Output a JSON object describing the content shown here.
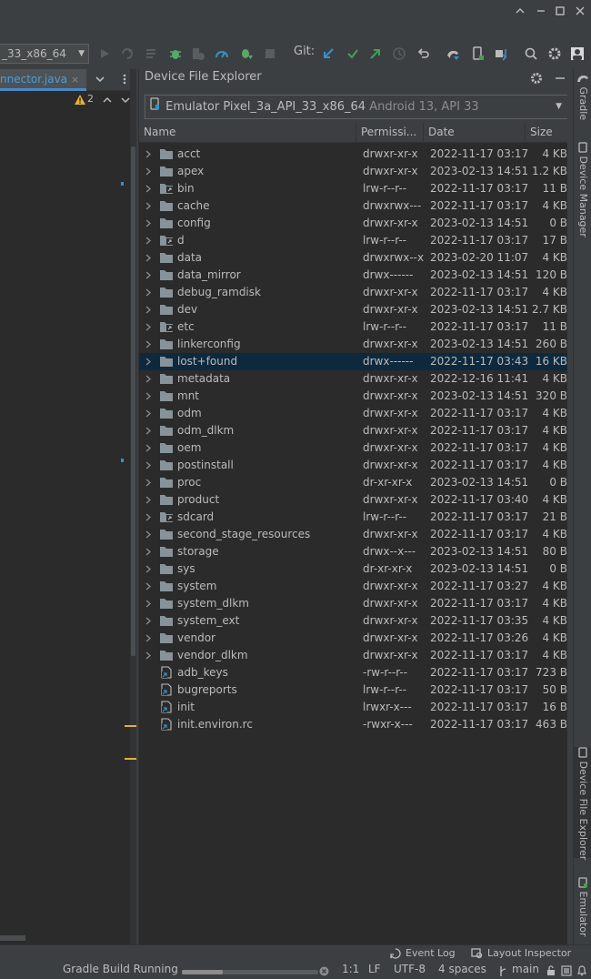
{
  "toolbar": {
    "run_config": "_33_x86_64",
    "git_label": "Git:"
  },
  "editor": {
    "tab_label": "nnector.java",
    "tab_close": "×",
    "warning_count": "2"
  },
  "panel": {
    "title": "Device File Explorer",
    "device_name": "Emulator Pixel_3a_API_33_x86_64",
    "device_api": "Android 13, API 33",
    "columns": {
      "name": "Name",
      "permissions": "Permissi...",
      "date": "Date",
      "size": "Size"
    }
  },
  "files": [
    {
      "name": "acct",
      "perm": "drwxr-xr-x",
      "date": "2022-11-17 03:17",
      "size": "4 KB",
      "kind": "folder"
    },
    {
      "name": "apex",
      "perm": "drwxr-xr-x",
      "date": "2023-02-13 14:51",
      "size": "1.2 KB",
      "kind": "folder"
    },
    {
      "name": "bin",
      "perm": "lrw-r--r--",
      "date": "2022-11-17 03:17",
      "size": "11 B",
      "kind": "folder-link"
    },
    {
      "name": "cache",
      "perm": "drwxrwx---",
      "date": "2022-11-17 03:17",
      "size": "4 KB",
      "kind": "folder"
    },
    {
      "name": "config",
      "perm": "drwxr-xr-x",
      "date": "2023-02-13 14:51",
      "size": "0 B",
      "kind": "folder"
    },
    {
      "name": "d",
      "perm": "lrw-r--r--",
      "date": "2022-11-17 03:17",
      "size": "17 B",
      "kind": "folder-link"
    },
    {
      "name": "data",
      "perm": "drwxrwx--x",
      "date": "2023-02-20 11:07",
      "size": "4 KB",
      "kind": "folder"
    },
    {
      "name": "data_mirror",
      "perm": "drwx------",
      "date": "2023-02-13 14:51",
      "size": "120 B",
      "kind": "folder"
    },
    {
      "name": "debug_ramdisk",
      "perm": "drwxr-xr-x",
      "date": "2022-11-17 03:17",
      "size": "4 KB",
      "kind": "folder"
    },
    {
      "name": "dev",
      "perm": "drwxr-xr-x",
      "date": "2023-02-13 14:51",
      "size": "2.7 KB",
      "kind": "folder"
    },
    {
      "name": "etc",
      "perm": "lrw-r--r--",
      "date": "2022-11-17 03:17",
      "size": "11 B",
      "kind": "folder-link"
    },
    {
      "name": "linkerconfig",
      "perm": "drwxr-xr-x",
      "date": "2023-02-13 14:51",
      "size": "260 B",
      "kind": "folder"
    },
    {
      "name": "lost+found",
      "perm": "drwx------",
      "date": "2022-11-17 03:43",
      "size": "16 KB",
      "kind": "folder",
      "selected": true
    },
    {
      "name": "metadata",
      "perm": "drwxr-xr-x",
      "date": "2022-12-16 11:41",
      "size": "4 KB",
      "kind": "folder"
    },
    {
      "name": "mnt",
      "perm": "drwxr-xr-x",
      "date": "2023-02-13 14:51",
      "size": "320 B",
      "kind": "folder"
    },
    {
      "name": "odm",
      "perm": "drwxr-xr-x",
      "date": "2022-11-17 03:17",
      "size": "4 KB",
      "kind": "folder"
    },
    {
      "name": "odm_dlkm",
      "perm": "drwxr-xr-x",
      "date": "2022-11-17 03:17",
      "size": "4 KB",
      "kind": "folder"
    },
    {
      "name": "oem",
      "perm": "drwxr-xr-x",
      "date": "2022-11-17 03:17",
      "size": "4 KB",
      "kind": "folder"
    },
    {
      "name": "postinstall",
      "perm": "drwxr-xr-x",
      "date": "2022-11-17 03:17",
      "size": "4 KB",
      "kind": "folder"
    },
    {
      "name": "proc",
      "perm": "dr-xr-xr-x",
      "date": "2023-02-13 14:51",
      "size": "0 B",
      "kind": "folder"
    },
    {
      "name": "product",
      "perm": "drwxr-xr-x",
      "date": "2022-11-17 03:40",
      "size": "4 KB",
      "kind": "folder"
    },
    {
      "name": "sdcard",
      "perm": "lrw-r--r--",
      "date": "2022-11-17 03:17",
      "size": "21 B",
      "kind": "folder-link"
    },
    {
      "name": "second_stage_resources",
      "perm": "drwxr-xr-x",
      "date": "2022-11-17 03:17",
      "size": "4 KB",
      "kind": "folder"
    },
    {
      "name": "storage",
      "perm": "drwx--x---",
      "date": "2023-02-13 14:51",
      "size": "80 B",
      "kind": "folder"
    },
    {
      "name": "sys",
      "perm": "dr-xr-xr-x",
      "date": "2023-02-13 14:51",
      "size": "0 B",
      "kind": "folder"
    },
    {
      "name": "system",
      "perm": "drwxr-xr-x",
      "date": "2022-11-17 03:27",
      "size": "4 KB",
      "kind": "folder"
    },
    {
      "name": "system_dlkm",
      "perm": "drwxr-xr-x",
      "date": "2022-11-17 03:17",
      "size": "4 KB",
      "kind": "folder"
    },
    {
      "name": "system_ext",
      "perm": "drwxr-xr-x",
      "date": "2022-11-17 03:35",
      "size": "4 KB",
      "kind": "folder"
    },
    {
      "name": "vendor",
      "perm": "drwxr-xr-x",
      "date": "2022-11-17 03:26",
      "size": "4 KB",
      "kind": "folder"
    },
    {
      "name": "vendor_dlkm",
      "perm": "drwxr-xr-x",
      "date": "2022-11-17 03:17",
      "size": "4 KB",
      "kind": "folder"
    },
    {
      "name": "adb_keys",
      "perm": "-rw-r--r--",
      "date": "2022-11-17 03:17",
      "size": "723 B",
      "kind": "file-link"
    },
    {
      "name": "bugreports",
      "perm": "lrw-r--r--",
      "date": "2022-11-17 03:17",
      "size": "50 B",
      "kind": "file-link"
    },
    {
      "name": "init",
      "perm": "lrwxr-x---",
      "date": "2022-11-17 03:17",
      "size": "16 B",
      "kind": "file-link"
    },
    {
      "name": "init.environ.rc",
      "perm": "-rwxr-x---",
      "date": "2022-11-17 03:17",
      "size": "463 B",
      "kind": "file-link"
    }
  ],
  "sidebar": {
    "gradle": "Gradle",
    "device_manager": "Device Manager",
    "device_file_explorer": "Device File Explorer",
    "emulator": "Emulator"
  },
  "tool_strip": {
    "event_log": "Event Log",
    "layout_inspector": "Layout Inspector"
  },
  "status": {
    "task": "Gradle Build Running",
    "position": "1:1",
    "line_sep": "LF",
    "encoding": "UTF-8",
    "indent": "4 spaces",
    "branch": "main"
  },
  "colors": {
    "accent": "#4a88c7",
    "selection": "#0d293e",
    "folder": "#87939a",
    "git_update": "#3592c4",
    "git_commit": "#499c54"
  }
}
